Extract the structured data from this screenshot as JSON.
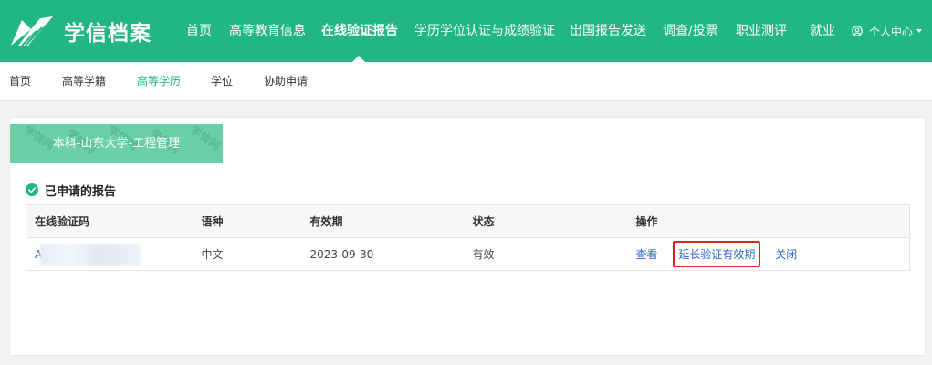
{
  "header": {
    "logo_text": "学信档案",
    "nav": [
      {
        "label": "首页",
        "active": false
      },
      {
        "label": "高等教育信息",
        "active": false
      },
      {
        "label": "在线验证报告",
        "active": true
      },
      {
        "label": "学历学位认证与成绩验证",
        "active": false
      },
      {
        "label": "出国报告发送",
        "active": false
      },
      {
        "label": "调查/投票",
        "active": false
      },
      {
        "label": "职业测评",
        "active": false
      },
      {
        "label": "就业",
        "active": false
      }
    ],
    "user_center": "个人中心"
  },
  "subnav": {
    "items": [
      {
        "label": "首页",
        "active": false
      },
      {
        "label": "高等学籍",
        "active": false
      },
      {
        "label": "高等学历",
        "active": true
      },
      {
        "label": "学位",
        "active": false
      },
      {
        "label": "协助申请",
        "active": false
      }
    ]
  },
  "degree_tab": {
    "label": "本科-山东大学-工程管理",
    "watermark": "学信网"
  },
  "section": {
    "title": "已申请的报告"
  },
  "table": {
    "headers": [
      "在线验证码",
      "语种",
      "有效期",
      "状态",
      "操作"
    ],
    "rows": [
      {
        "code_visible": "A",
        "language": "中文",
        "valid_until": "2023-09-30",
        "status": "有效",
        "actions": {
          "view": "查看",
          "extend": "延长验证有效期",
          "close": "关闭"
        }
      }
    ]
  },
  "colors": {
    "brand_green": "#22b585",
    "tab_green": "#6dcfa9",
    "link_blue": "#3366cc",
    "highlight_red": "#e0241b"
  }
}
